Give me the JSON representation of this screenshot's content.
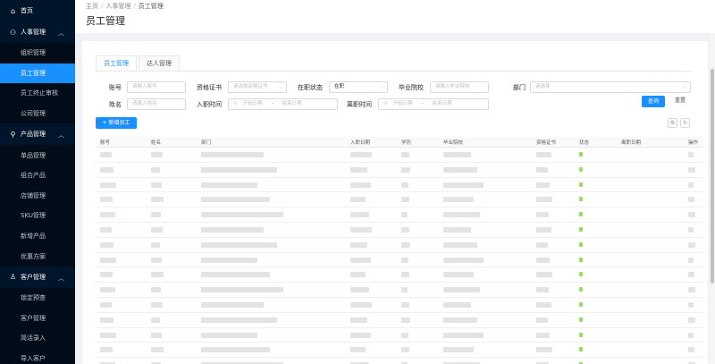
{
  "sidebar": {
    "home": "首页",
    "groups": [
      {
        "label": "人事管理",
        "items": [
          "组织管理",
          "员工管理",
          "员工终止审核",
          "公司管理"
        ],
        "active": 1
      },
      {
        "label": "产品管理",
        "items": [
          "单品管理",
          "组合产品",
          "店铺管理",
          "SKU管理",
          "新增产品",
          "优惠方案"
        ],
        "active": -1
      },
      {
        "label": "客户管理",
        "items": [
          "锁定预查",
          "客户管理",
          "简活录入",
          "导入客户"
        ],
        "active": -1
      }
    ]
  },
  "breadcrumb": {
    "home": "主页",
    "parent": "人事管理",
    "current": "员工管理"
  },
  "page_title": "员工管理",
  "tabs": [
    "员工管理",
    "达人管理"
  ],
  "filters": {
    "account": {
      "label": "账号",
      "placeholder": "请输入账号"
    },
    "cert": {
      "label": "资格证书",
      "placeholder": "请选择资格证书"
    },
    "status": {
      "label": "在职状态",
      "value": "在职"
    },
    "school": {
      "label": "毕业院校",
      "placeholder": "请输入毕业院校"
    },
    "dept": {
      "label": "部门",
      "placeholder": "请选择"
    },
    "name": {
      "label": "姓名",
      "placeholder": "请输入姓名"
    },
    "join_date": {
      "label": "入职时间",
      "start": "开始日期",
      "end": "结束日期"
    },
    "leave_date": {
      "label": "离职时间",
      "start": "开始日期",
      "end": "结束日期"
    }
  },
  "buttons": {
    "query": "查询",
    "reset": "重置",
    "add": "新增员工"
  },
  "table": {
    "columns": [
      "账号",
      "姓名",
      "部门",
      "入职日期",
      "学历",
      "毕业院校",
      "资格证书",
      "状态",
      "离职日期",
      "操作"
    ]
  }
}
